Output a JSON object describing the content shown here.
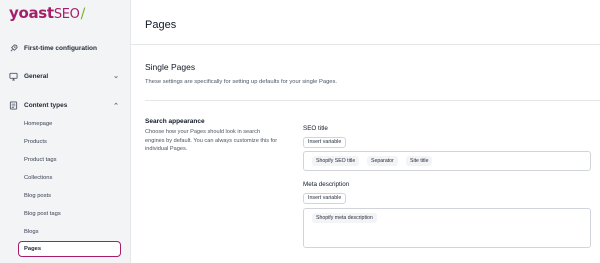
{
  "logo": {
    "brand": "yoast",
    "suffix": "SEO",
    "slash": "/"
  },
  "sidebar": {
    "first_time": "First-time configuration",
    "general": "General",
    "content_types": "Content types",
    "items": [
      "Homepage",
      "Products",
      "Product tags",
      "Collections",
      "Blog posts",
      "Blog post tags",
      "Blogs",
      "Pages"
    ],
    "active_item": "Pages"
  },
  "main": {
    "title": "Pages",
    "section_title": "Single Pages",
    "section_desc": "These settings are specifically for setting up defaults for your single Pages.",
    "search_appearance": {
      "title": "Search appearance",
      "desc": "Choose how your Pages should look in search engines by default. You can always customize this for individual Pages."
    },
    "seo_title": {
      "label": "SEO title",
      "insert_button": "Insert variable",
      "tags": [
        "Shopify SEO title",
        "Separator",
        "Site title"
      ]
    },
    "meta_description": {
      "label": "Meta description",
      "insert_button": "Insert variable",
      "tags": [
        "Shopify meta description"
      ]
    }
  },
  "colors": {
    "brand": "#a61e69",
    "accent": "#77b227"
  }
}
